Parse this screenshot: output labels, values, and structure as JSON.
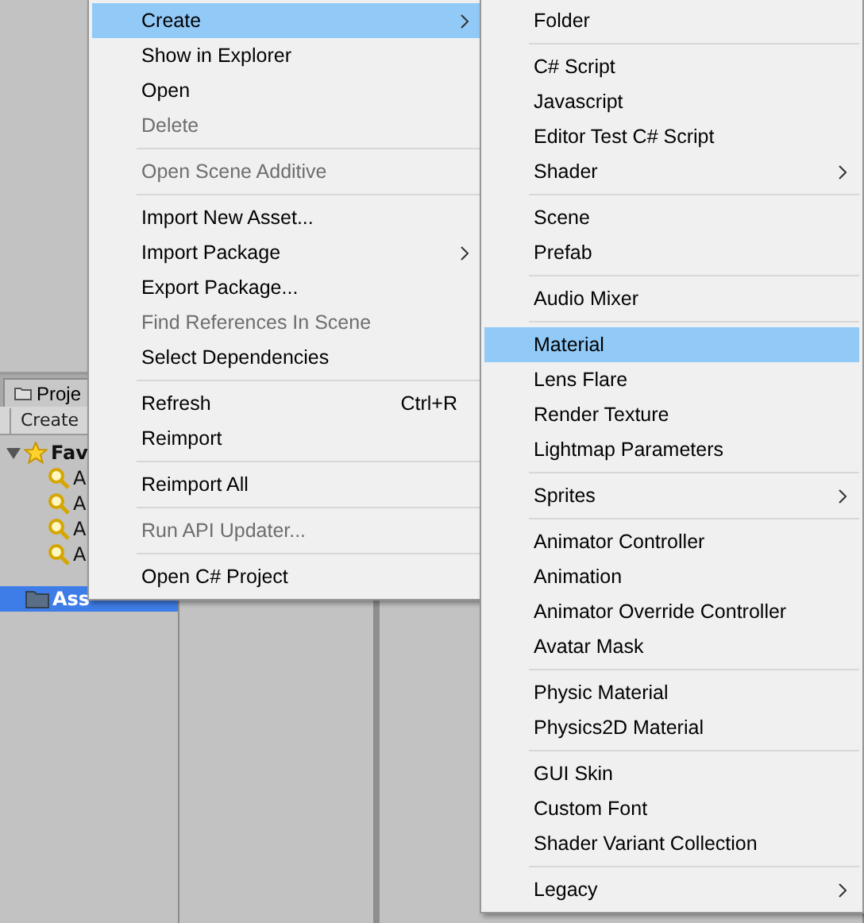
{
  "project_panel": {
    "tab": "Proje",
    "toolbar_button": "Create",
    "favorites": {
      "label": "Fav",
      "expanded": true,
      "items": [
        "A",
        "A",
        "A",
        "A"
      ]
    },
    "assets": {
      "label": "Ass",
      "selected": true
    }
  },
  "context_menu": {
    "items": [
      {
        "kind": "item",
        "label": "Create",
        "selected": true,
        "disabled": false,
        "submenu": true
      },
      {
        "kind": "item",
        "label": "Show in Explorer",
        "selected": false,
        "disabled": false,
        "submenu": false
      },
      {
        "kind": "item",
        "label": "Open",
        "selected": false,
        "disabled": false,
        "submenu": false
      },
      {
        "kind": "item",
        "label": "Delete",
        "selected": false,
        "disabled": true,
        "submenu": false
      },
      {
        "kind": "separator"
      },
      {
        "kind": "item",
        "label": "Open Scene Additive",
        "selected": false,
        "disabled": true,
        "submenu": false
      },
      {
        "kind": "separator"
      },
      {
        "kind": "item",
        "label": "Import New Asset...",
        "selected": false,
        "disabled": false,
        "submenu": false
      },
      {
        "kind": "item",
        "label": "Import Package",
        "selected": false,
        "disabled": false,
        "submenu": true
      },
      {
        "kind": "item",
        "label": "Export Package...",
        "selected": false,
        "disabled": false,
        "submenu": false
      },
      {
        "kind": "item",
        "label": "Find References In Scene",
        "selected": false,
        "disabled": true,
        "submenu": false
      },
      {
        "kind": "item",
        "label": "Select Dependencies",
        "selected": false,
        "disabled": false,
        "submenu": false
      },
      {
        "kind": "separator"
      },
      {
        "kind": "item",
        "label": "Refresh",
        "shortcut": "Ctrl+R",
        "selected": false,
        "disabled": false,
        "submenu": false
      },
      {
        "kind": "item",
        "label": "Reimport",
        "selected": false,
        "disabled": false,
        "submenu": false
      },
      {
        "kind": "separator"
      },
      {
        "kind": "item",
        "label": "Reimport All",
        "selected": false,
        "disabled": false,
        "submenu": false
      },
      {
        "kind": "separator"
      },
      {
        "kind": "item",
        "label": "Run API Updater...",
        "selected": false,
        "disabled": true,
        "submenu": false
      },
      {
        "kind": "separator"
      },
      {
        "kind": "item",
        "label": "Open C# Project",
        "selected": false,
        "disabled": false,
        "submenu": false
      }
    ]
  },
  "create_submenu": {
    "items": [
      {
        "kind": "item",
        "label": "Folder",
        "selected": false,
        "disabled": false,
        "submenu": false
      },
      {
        "kind": "separator"
      },
      {
        "kind": "item",
        "label": "C# Script",
        "selected": false,
        "disabled": false,
        "submenu": false
      },
      {
        "kind": "item",
        "label": "Javascript",
        "selected": false,
        "disabled": false,
        "submenu": false
      },
      {
        "kind": "item",
        "label": "Editor Test C# Script",
        "selected": false,
        "disabled": false,
        "submenu": false
      },
      {
        "kind": "item",
        "label": "Shader",
        "selected": false,
        "disabled": false,
        "submenu": true
      },
      {
        "kind": "separator"
      },
      {
        "kind": "item",
        "label": "Scene",
        "selected": false,
        "disabled": false,
        "submenu": false
      },
      {
        "kind": "item",
        "label": "Prefab",
        "selected": false,
        "disabled": false,
        "submenu": false
      },
      {
        "kind": "separator"
      },
      {
        "kind": "item",
        "label": "Audio Mixer",
        "selected": false,
        "disabled": false,
        "submenu": false
      },
      {
        "kind": "separator"
      },
      {
        "kind": "item",
        "label": "Material",
        "selected": true,
        "disabled": false,
        "submenu": false
      },
      {
        "kind": "item",
        "label": "Lens Flare",
        "selected": false,
        "disabled": false,
        "submenu": false
      },
      {
        "kind": "item",
        "label": "Render Texture",
        "selected": false,
        "disabled": false,
        "submenu": false
      },
      {
        "kind": "item",
        "label": "Lightmap Parameters",
        "selected": false,
        "disabled": false,
        "submenu": false
      },
      {
        "kind": "separator"
      },
      {
        "kind": "item",
        "label": "Sprites",
        "selected": false,
        "disabled": false,
        "submenu": true
      },
      {
        "kind": "separator"
      },
      {
        "kind": "item",
        "label": "Animator Controller",
        "selected": false,
        "disabled": false,
        "submenu": false
      },
      {
        "kind": "item",
        "label": "Animation",
        "selected": false,
        "disabled": false,
        "submenu": false
      },
      {
        "kind": "item",
        "label": "Animator Override Controller",
        "selected": false,
        "disabled": false,
        "submenu": false
      },
      {
        "kind": "item",
        "label": "Avatar Mask",
        "selected": false,
        "disabled": false,
        "submenu": false
      },
      {
        "kind": "separator"
      },
      {
        "kind": "item",
        "label": "Physic Material",
        "selected": false,
        "disabled": false,
        "submenu": false
      },
      {
        "kind": "item",
        "label": "Physics2D Material",
        "selected": false,
        "disabled": false,
        "submenu": false
      },
      {
        "kind": "separator"
      },
      {
        "kind": "item",
        "label": "GUI Skin",
        "selected": false,
        "disabled": false,
        "submenu": false
      },
      {
        "kind": "item",
        "label": "Custom Font",
        "selected": false,
        "disabled": false,
        "submenu": false
      },
      {
        "kind": "item",
        "label": "Shader Variant Collection",
        "selected": false,
        "disabled": false,
        "submenu": false
      },
      {
        "kind": "separator"
      },
      {
        "kind": "item",
        "label": "Legacy",
        "selected": false,
        "disabled": false,
        "submenu": true
      }
    ]
  }
}
